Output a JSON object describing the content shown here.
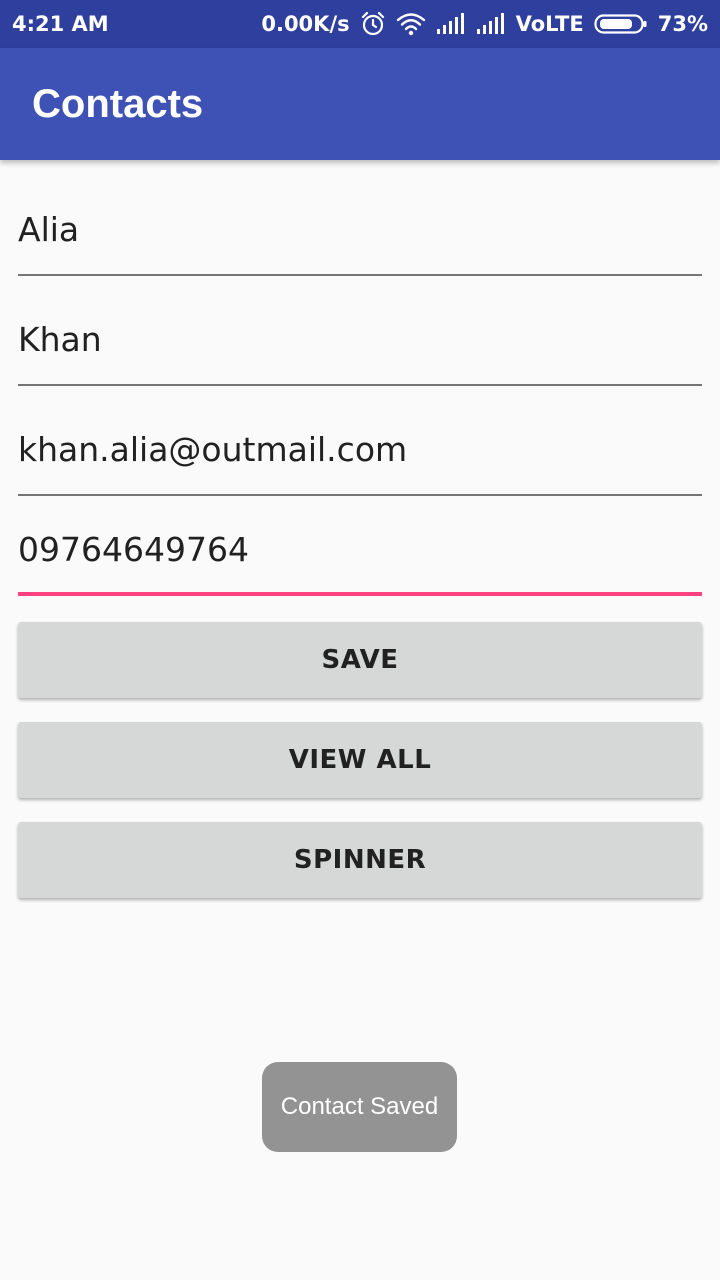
{
  "status_bar": {
    "time": "4:21 AM",
    "net_speed": "0.00K/s",
    "network_type": "VoLTE",
    "battery": "73%",
    "icons": [
      "alarm-icon",
      "wifi-icon",
      "signal-icon",
      "signal-icon",
      "battery-icon"
    ]
  },
  "app_bar": {
    "title": "Contacts"
  },
  "form": {
    "first_name": "Alia",
    "last_name": "Khan",
    "email": "khan.alia@outmail.com",
    "phone": "09764649764"
  },
  "buttons": {
    "save": "SAVE",
    "view_all": "VIEW ALL",
    "spinner": "SPINNER"
  },
  "toast": {
    "message": "Contact Saved"
  },
  "colors": {
    "status_bar": "#2f3f9e",
    "primary": "#3e51b5",
    "accent": "#ff4081",
    "button": "#d6d7d7",
    "toast": "#939393"
  }
}
